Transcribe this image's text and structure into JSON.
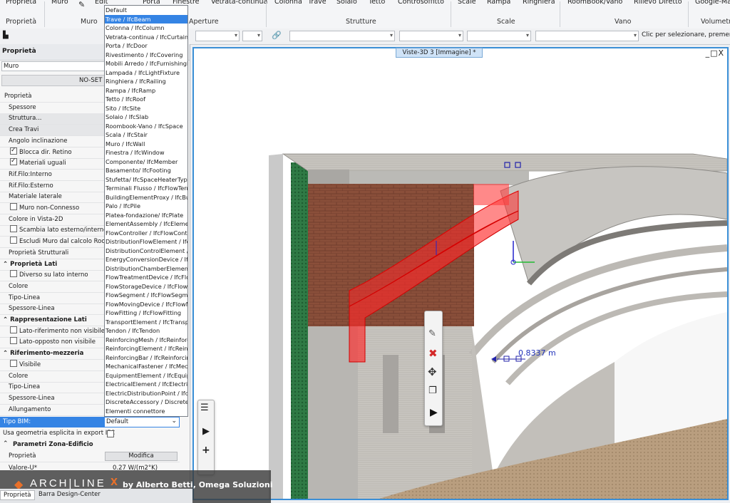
{
  "ribbon": {
    "top_items": [
      "Proprietà",
      "Muro",
      "Edit",
      "Porta",
      "Finestre",
      "Vetrata-continua",
      "Colonna",
      "Trave",
      "Solaio",
      "Tetto",
      "Controsoffitto",
      "Scale",
      "Rampa",
      "Ringhiera",
      "RoomBook/Vano",
      "Rilievo Diretto",
      "Google-Ma"
    ],
    "groups": [
      "Proprietà",
      "Muro",
      "Aperture",
      "Strutture",
      "Scale",
      "Vano",
      "Volumetr"
    ]
  },
  "toolbar2": {
    "status_placeholder": "Clic per selezionare, premere M"
  },
  "left_panel": {
    "title": "Proprietà",
    "element_type": "Muro",
    "noset_label": "NO-SET",
    "rows": [
      {
        "label": "Proprietà",
        "kind": "plain"
      },
      {
        "label": "Spessore",
        "kind": "plain"
      },
      {
        "label": "Struttura...",
        "kind": "grey"
      },
      {
        "label": "Crea Travi",
        "kind": "grey"
      },
      {
        "label": "Angolo inclinazione",
        "kind": "plain"
      },
      {
        "label": "Blocca dir. Retino",
        "kind": "check",
        "checked": true
      },
      {
        "label": "Materiali uguali",
        "kind": "check",
        "checked": true
      },
      {
        "label": "Rif.Filo:Interno",
        "kind": "plain"
      },
      {
        "label": "Rif.Filo:Esterno",
        "kind": "plain"
      },
      {
        "label": "Materiale laterale",
        "kind": "plain"
      },
      {
        "label": "Muro non-Connesso",
        "kind": "check",
        "checked": false
      },
      {
        "label": "Colore in Vista-2D",
        "kind": "plain"
      },
      {
        "label": "Scambia lato esterno/interno",
        "kind": "check",
        "checked": false
      },
      {
        "label": "Escludi Muro dal calcolo Roombo",
        "kind": "check",
        "checked": false
      },
      {
        "label": "Proprietà Strutturali",
        "kind": "plain"
      },
      {
        "label": "Proprietà Lati",
        "kind": "section"
      },
      {
        "label": "Diverso su lato interno",
        "kind": "check",
        "checked": false
      },
      {
        "label": "Colore",
        "kind": "plain"
      },
      {
        "label": "Tipo-Linea",
        "kind": "plain"
      },
      {
        "label": "Spessore-Linea",
        "kind": "plain"
      },
      {
        "label": "Rappresentazione Lati",
        "kind": "section"
      },
      {
        "label": "Lato-riferimento non visibile",
        "kind": "check",
        "checked": false
      },
      {
        "label": "Lato-opposto non visibile",
        "kind": "check",
        "checked": false
      },
      {
        "label": "Riferimento-mezzeria",
        "kind": "section"
      },
      {
        "label": "Visibile",
        "kind": "check",
        "checked": false
      },
      {
        "label": "Colore",
        "kind": "plain"
      },
      {
        "label": "Tipo-Linea",
        "kind": "plain"
      },
      {
        "label": "Spessore-Linea",
        "kind": "plain"
      },
      {
        "label": "Allungamento",
        "kind": "plain"
      }
    ],
    "tipo_bim_label": "Tipo BIM:",
    "tipo_bim_value": "Default",
    "ifc_geometry_label": "Usa geometria esplicita in export IFC",
    "zona_section": "Parametri Zona-Edificio",
    "proprieta_label": "Proprietà",
    "modifica_label": "Modifica",
    "valore_u_label": "Valore-U*",
    "valore_u_value": "0.27 W/(m2°K)",
    "bottom_tabs": [
      "Proprietà",
      "Barra Design-Center"
    ]
  },
  "dropdown": {
    "selected_index": 1,
    "items": [
      "Default",
      "Trave / IfcBeam",
      "Colonna / IfcColumn",
      "Vetrata-continua / IfcCurtainW",
      "Porta / IfcDoor",
      "Rivestimento / IfcCovering",
      "Mobili Arredo / IfcFurnishingEle",
      "Lampada / IfcLightFixture",
      "Ringhiera / IfcRailing",
      "Rampa / IfcRamp",
      "Tetto / IfcRoof",
      "Sito / IfcSite",
      "Solaio / IfcSlab",
      "Roombook-Vano / IfcSpace",
      "Scala / IfcStair",
      "Muro / IfcWall",
      "Finestra / IfcWindow",
      "Componente/ IfcMember",
      "Basamento/ IfcFooting",
      "Stufetta/ IfcSpaceHeaterType",
      "Terminali Flusso / IfcFlowTermin",
      "BuildingElementProxy / IfcBuildi",
      "Palo / IfcPile",
      "Platea-fondazione/ IfcPlate",
      "ElementAssembly / IfcElementA",
      "FlowController / IfcFlowControl",
      "DistributionFlowElement / IfcDis",
      "DistributionControlElement / Ifc",
      "EnergyConversionDevice / IfcE",
      "DistributionChamberElement / I",
      "FlowTreatmentDevice / IfcFlow",
      "FlowStorageDevice / IfcFlowSt",
      "FlowSegment / IfcFlowSegmen",
      "FlowMovingDevice / IfcFlowMo",
      "FlowFitting / IfcFlowFitting",
      "TransportElement / IfcTranspor",
      "Tendon / IfcTendon",
      "ReinforcingMesh / IfcReinforcin",
      "ReinforcingElement / IfcReinfor",
      "ReinforcingBar / IfcReinforcing",
      "MechanicalFastener / IfcMecha",
      "EquipmentElement / IfcEquipme",
      "ElectricalElement / IfcElectricalE",
      "ElectricDistributionPoint / IfcEle",
      "DiscreteAccessory / DiscreteAc",
      "Elementi connettore"
    ]
  },
  "viewport": {
    "title": "Viste-3D 3 [Immagine] *",
    "dimension_label": "0.8337 m",
    "window_controls": "_□X"
  },
  "banner": {
    "brand": "ARCH|LINE",
    "brand_suffix": "X",
    "credit": "by Alberto Betti, Omega Soluzioni"
  },
  "colors": {
    "accent": "#3584e4",
    "beam_red": "#ff2a2a",
    "brick": "#8a4f3a",
    "greenery": "#2f7a45"
  }
}
